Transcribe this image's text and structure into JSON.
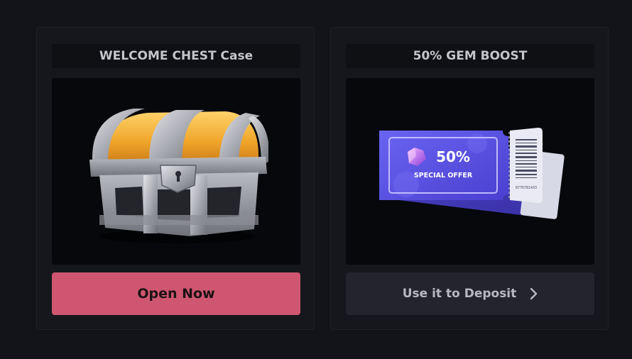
{
  "cards": [
    {
      "title": "WELCOME CHEST Case",
      "image": "treasure-chest",
      "button_label": "Open Now",
      "button_color": "#cf5670"
    },
    {
      "title": "50% GEM BOOST",
      "image": "coupon-ticket",
      "ticket_percent": "50%",
      "ticket_label": "SPECIAL OFFER",
      "ticket_serial": "8776781433",
      "button_label": "Use it to Deposit",
      "button_icon": "chevron-right-icon",
      "button_color": "#24252c"
    }
  ]
}
